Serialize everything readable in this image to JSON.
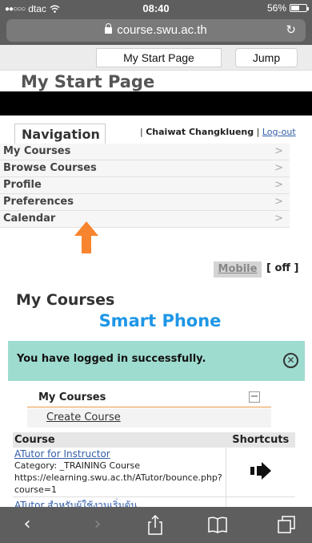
{
  "status_bar": {
    "carrier": "dtac",
    "time": "08:40",
    "battery": "56%",
    "battery_level": 0.56
  },
  "browser": {
    "url": "course.swu.ac.th"
  },
  "toolbar": {
    "select_value": "My Start Page",
    "jump_label": "Jump"
  },
  "header": {
    "title": "My Start Page"
  },
  "navigation": {
    "tab_label": "Navigation",
    "user_name": "Chaiwat Changklueng",
    "separator": "|",
    "logout_label": "Log-out",
    "items": [
      {
        "label": "My Courses"
      },
      {
        "label": "Browse Courses"
      },
      {
        "label": "Profile"
      },
      {
        "label": "Preferences"
      },
      {
        "label": "Calendar"
      }
    ],
    "chevron": ">"
  },
  "mobile_toggle": {
    "mobile_label": "Mobile",
    "state_label": "[ off ]"
  },
  "main": {
    "heading": "My Courses",
    "overlay_caption": "Smart Phone",
    "success_message": "You have logged in successfully.",
    "box": {
      "title": "My Courses",
      "collapse_symbol": "−",
      "create_label": "Create Course"
    },
    "table": {
      "col_course": "Course",
      "col_shortcuts": "Shortcuts",
      "rows": [
        {
          "title": "ATutor for Instructor",
          "category": "Category: _TRAINING Course",
          "link": "https://elearning.swu.ac.th/ATutor/bounce.php?course=1"
        },
        {
          "title": "ATutor สำหรับผู้ใช้งานเริ่มต้น"
        }
      ]
    }
  },
  "colors": {
    "chrome": "#5e5e5e",
    "accent_blue": "#1e96e6",
    "success_bg": "#9fdcd0",
    "arrow_orange": "#f7842e",
    "link": "#335ea8"
  },
  "icons": {
    "wifi": "wifi-icon",
    "lock": "lock-icon",
    "reload": "reload-icon",
    "back": "back-icon",
    "forward": "forward-icon",
    "share": "share-icon",
    "bookmarks": "bookmarks-icon",
    "tabs": "tabs-icon"
  }
}
